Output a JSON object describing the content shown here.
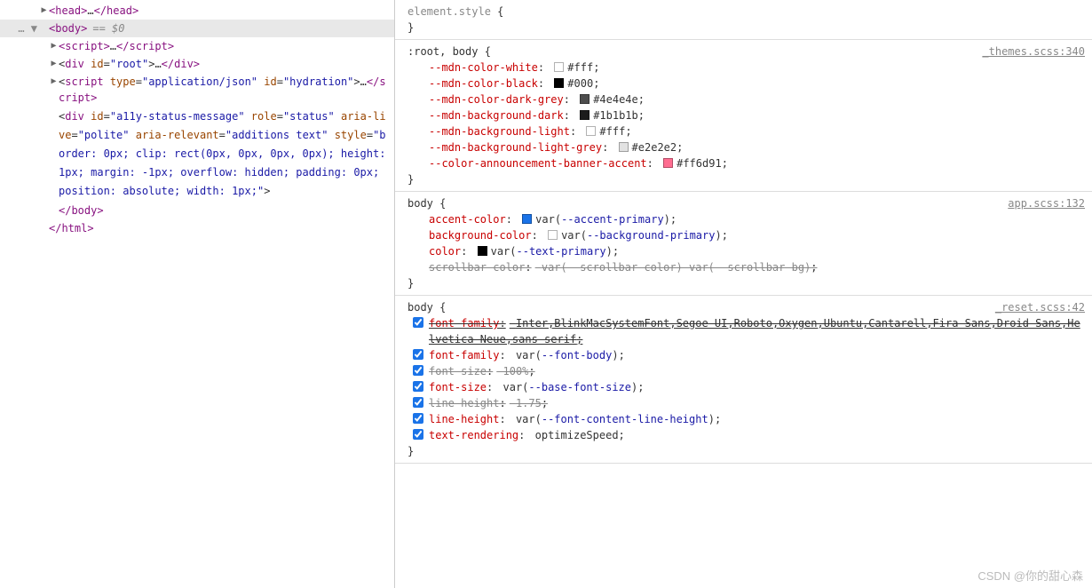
{
  "dom_tree": {
    "head": {
      "open": "<head>",
      "ellipsis": "…",
      "close": "</head>"
    },
    "body_row": {
      "gutter": "… ▼",
      "open": "<body>",
      "hint": "== $0"
    },
    "script1": {
      "open": "<script>",
      "ellipsis": "…",
      "close": "</script>"
    },
    "div_root": {
      "open_tag": "div",
      "id_attr": "id",
      "id_val": "\"root\"",
      "ellipsis": "…",
      "close": "</div>"
    },
    "script2": {
      "open_tag": "script",
      "type_attr": "type",
      "type_val": "\"application/json\"",
      "id_attr": "id",
      "id_val": "\"hydration\"",
      "ellipsis": "…",
      "close": "</script>"
    },
    "a11y": {
      "open_tag": "div",
      "attrs": "id=\"a11y-status-message\" role=\"status\" aria-live=\"polite\" aria-relevant=\"additions text\" style=\"border: 0px; clip: rect(0px, 0px, 0px, 0px); height: 1px; margin: -1px; overflow: hidden; padding: 0px; position: absolute; width: 1px;\"",
      "close": "</div>"
    },
    "body_close": "</body>",
    "html_close": "</html>"
  },
  "styles": {
    "rule0": {
      "selector": "element.style",
      "open": "{",
      "close": "}"
    },
    "rule1": {
      "selector": ":root, body",
      "open": "{",
      "close": "}",
      "source": "_themes.scss:340",
      "decls": [
        {
          "prop": "--mdn-color-white",
          "swatch": "#ffffff",
          "val": "#fff",
          "end": ";"
        },
        {
          "prop": "--mdn-color-black",
          "swatch": "#000000",
          "val": "#000",
          "end": ";"
        },
        {
          "prop": "--mdn-color-dark-grey",
          "swatch": "#4e4e4e",
          "val": "#4e4e4e",
          "end": ";"
        },
        {
          "prop": "--mdn-background-dark",
          "swatch": "#1b1b1b",
          "val": "#1b1b1b",
          "end": ";"
        },
        {
          "prop": "--mdn-background-light",
          "swatch": "#ffffff",
          "val": "#fff",
          "end": ";"
        },
        {
          "prop": "--mdn-background-light-grey",
          "swatch": "#e2e2e2",
          "val": "#e2e2e2",
          "end": ";"
        },
        {
          "prop": "--color-announcement-banner-accent",
          "swatch": "#ff6d91",
          "val": "#ff6d91",
          "end": ";"
        }
      ]
    },
    "rule2": {
      "selector": "body",
      "open": "{",
      "close": "}",
      "source": "app.scss:132",
      "decls": [
        {
          "prop": "accent-color",
          "swatch": "#1a73e8",
          "valpre": "var(",
          "varname": "--accent-primary",
          "valpost": ")",
          "end": ";"
        },
        {
          "prop": "background-color",
          "swatch": "#ffffff",
          "valpre": "var(",
          "varname": "--background-primary",
          "valpost": ")",
          "end": ";"
        },
        {
          "prop": "color",
          "swatch": "#000000",
          "valpre": "var(",
          "varname": "--text-primary",
          "valpost": ")",
          "end": ";"
        },
        {
          "strike": true,
          "prop": "scrollbar-color",
          "val": "var(--scrollbar-color) var(--scrollbar-bg)",
          "end": ";"
        }
      ]
    },
    "rule3": {
      "selector": "body",
      "open": "{",
      "close": "}",
      "source": "_reset.scss:42",
      "decls": [
        {
          "check": true,
          "strike": true,
          "underline": true,
          "prop": "font-family",
          "val": "Inter,BlinkMacSystemFont,Segoe UI,Roboto,Oxygen,Ubuntu,Cantarell,Fira Sans,Droid Sans,Helvetica Neue,sans-serif",
          "end": ";"
        },
        {
          "check": true,
          "prop": "font-family",
          "valpre": "var(",
          "varname": "--font-body",
          "valpost": ")",
          "end": ";"
        },
        {
          "check": true,
          "strike": true,
          "prop": "font-size",
          "val": "100%",
          "end": ";"
        },
        {
          "check": true,
          "prop": "font-size",
          "valpre": "var(",
          "varname": "--base-font-size",
          "valpost": ")",
          "end": ";"
        },
        {
          "check": true,
          "strike": true,
          "prop": "line-height",
          "val": "1.75",
          "end": ";"
        },
        {
          "check": true,
          "prop": "line-height",
          "valpre": "var(",
          "varname": "--font-content-line-height",
          "valpost": ")",
          "end": ";"
        },
        {
          "check": true,
          "prop": "text-rendering",
          "val": "optimizeSpeed",
          "end": ";"
        }
      ]
    }
  },
  "watermark": "CSDN @你的甜心森"
}
